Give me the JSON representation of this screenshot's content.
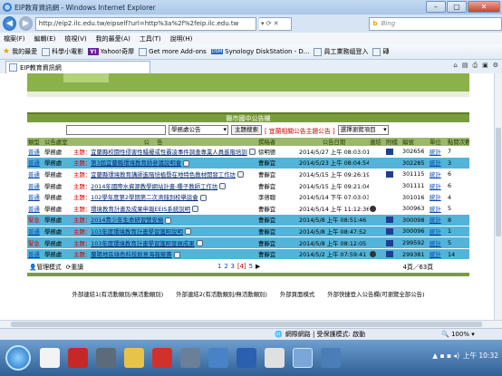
{
  "window": {
    "title": "EIP教育資訊網 - Windows Internet Explorer",
    "min": "–",
    "max": "▢",
    "close": "✕"
  },
  "address": {
    "url": "http://eip2.ilc.edu.tw/eipself?url=http%3a%2f%2feip.ilc.edu.tw",
    "search_placeholder": "Bing"
  },
  "menu": [
    "檔案(F)",
    "編輯(E)",
    "檢視(V)",
    "我的最愛(A)",
    "工具(T)",
    "說明(H)"
  ],
  "favorites": [
    {
      "label": "我的最愛"
    },
    {
      "label": "科學小電影"
    },
    {
      "label": "Yahoo!奇摩",
      "brand": "Y!"
    },
    {
      "label": "Get more Add-ons"
    },
    {
      "label": "Synology DiskStation - D..."
    },
    {
      "label": "員工業務組登入"
    },
    {
      "label": "磚"
    }
  ],
  "tab": {
    "label": "EIP教育資訊網"
  },
  "panel": {
    "title": "縣市國中公告欄",
    "search_select": "學務處公告",
    "search_button": "主題搜索",
    "red_link": "[ 宜蘭相關公告主題公告 ]",
    "filter_select": "選擇瀏覽項目"
  },
  "columns": [
    "類型",
    "公告處室",
    "公",
    "告",
    "撰稿者",
    "公告日期",
    "連結",
    "附檔",
    "編號",
    "單位",
    "點閱次數"
  ],
  "rows": [
    {
      "type": "普通",
      "dept": "學務處",
      "tag": "主題：",
      "subject": "宜蘭縣校園性侵害性騷擾或性霸凌事件調查專業人員進階培訓",
      "author": "徐明德",
      "date": "2014/5/27 上午 08:03:01",
      "link": "",
      "att": "",
      "id": "302656",
      "unit": "統計",
      "count": "7",
      "style": "w"
    },
    {
      "type": "普通",
      "dept": "學務處",
      "tag": "主題：",
      "subject": "第3屆宜蘭縣環境教育師參議說明會",
      "author": "曹靜宜",
      "date": "2014/5/23 上午 08:04:54",
      "link": "",
      "att": "",
      "id": "302285",
      "unit": "統計",
      "count": "3",
      "style": "b"
    },
    {
      "type": "普通",
      "dept": "學務處",
      "tag": "主題：",
      "subject": "宜蘭縣環境教育講師進階培植暨在地特色教材開發工作坊",
      "author": "曹靜宜",
      "date": "2014/5/15 上午 09:26:19",
      "link": "",
      "att": "",
      "id": "301115",
      "unit": "統計",
      "count": "6",
      "style": "w"
    },
    {
      "type": "普通",
      "dept": "學務處",
      "tag": "主題：",
      "subject": "2014年國際水資源教學網站計畫-種子教師工作坊",
      "author": "曹靜宜",
      "date": "2014/5/15 上午 09:21:04",
      "link": "",
      "att": "",
      "id": "301111",
      "unit": "統計",
      "count": "6",
      "style": "w"
    },
    {
      "type": "普通",
      "dept": "學務處",
      "tag": "主題：",
      "subject": "102學年度第2學期第二次濟錢到校舉談會",
      "author": "李啓聰",
      "date": "2014/5/14 下午 07:03:03",
      "link": "",
      "att": "",
      "id": "301016",
      "unit": "統計",
      "count": "4",
      "style": "w"
    },
    {
      "type": "普通",
      "dept": "學務處",
      "tag": "主題：",
      "subject": "環境教育計畫及成果申報EEIS系統說明",
      "author": "曹靜宜",
      "date": "2014/5/14 上午 11:12:36",
      "link": "",
      "att": "",
      "id": "300963",
      "unit": "統計",
      "count": "5",
      "style": "w"
    },
    {
      "type": "緊急",
      "dept": "學務處",
      "tag": "主題：",
      "subject": "2014青少年生命研習營安檢",
      "author": "曹靜宜",
      "date": "2014/5/8 上午 08:51:46",
      "link": "",
      "att": "",
      "id": "300098",
      "unit": "統計",
      "count": "8",
      "style": "b"
    },
    {
      "type": "普通",
      "dept": "學務處",
      "tag": "主題：",
      "subject": "103年度環境教育計畫學習護照說明",
      "author": "曹靜宜",
      "date": "2014/5/8 上午 08:47:52",
      "link": "",
      "att": "",
      "id": "300096",
      "unit": "統計",
      "count": "1",
      "style": "b"
    },
    {
      "type": "緊急",
      "dept": "學務處",
      "tag": "主題：",
      "subject": "103年度環境教育計畫學習護照發展成果",
      "author": "曹靜宜",
      "date": "2014/5/8 上午 08:12:05",
      "link": "",
      "att": "",
      "id": "299592",
      "unit": "統計",
      "count": "5",
      "style": "b"
    },
    {
      "type": "普通",
      "dept": "學務處",
      "tag": "主題：",
      "subject": "蘭陽地區綠色科技創意海報競賽",
      "author": "曹靜宜",
      "date": "2014/5/2 上午 07:59:41",
      "link": "",
      "att": "",
      "id": "299381",
      "unit": "統計",
      "count": "14",
      "style": "b"
    }
  ],
  "footer": {
    "manage": "管理模式",
    "refresh": "重讀",
    "pages": [
      "1",
      "2",
      "3",
      "[4]",
      "5"
    ],
    "count": "4頁／63頁"
  },
  "external_links": [
    "外部連結1(有活動類別/無活動類別)",
    "外部連結2(有活動類別/無活動類別)",
    "外部頁面模式",
    "外部快捷登入公告欄(可瀏覽全部公告)"
  ],
  "status": {
    "zone": "網際網路 | 受保護模式: 啟動",
    "zoom": "100%"
  },
  "taskbar": {
    "time": "上午 10:32"
  }
}
